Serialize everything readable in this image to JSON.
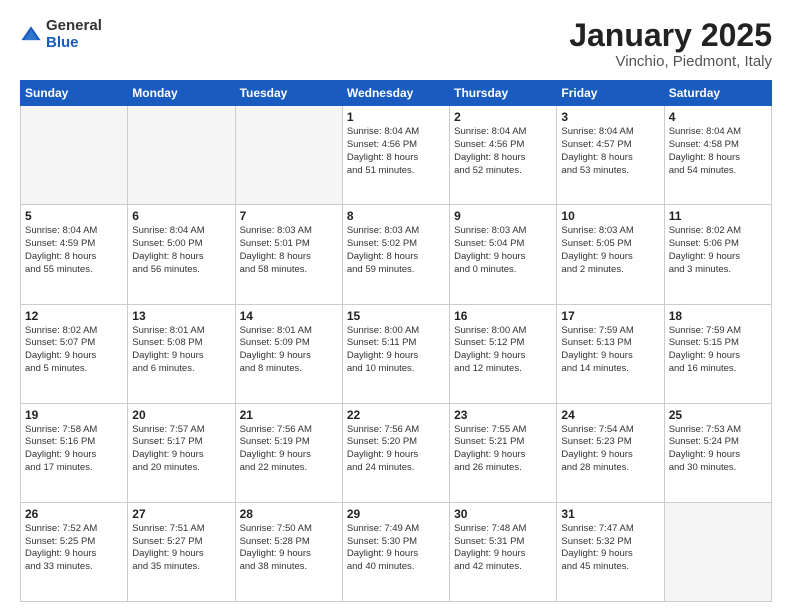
{
  "header": {
    "logo": {
      "general": "General",
      "blue": "Blue"
    },
    "title": "January 2025",
    "location": "Vinchio, Piedmont, Italy"
  },
  "weekdays": [
    "Sunday",
    "Monday",
    "Tuesday",
    "Wednesday",
    "Thursday",
    "Friday",
    "Saturday"
  ],
  "weeks": [
    [
      {
        "day": "",
        "detail": ""
      },
      {
        "day": "",
        "detail": ""
      },
      {
        "day": "",
        "detail": ""
      },
      {
        "day": "1",
        "detail": "Sunrise: 8:04 AM\nSunset: 4:56 PM\nDaylight: 8 hours\nand 51 minutes."
      },
      {
        "day": "2",
        "detail": "Sunrise: 8:04 AM\nSunset: 4:56 PM\nDaylight: 8 hours\nand 52 minutes."
      },
      {
        "day": "3",
        "detail": "Sunrise: 8:04 AM\nSunset: 4:57 PM\nDaylight: 8 hours\nand 53 minutes."
      },
      {
        "day": "4",
        "detail": "Sunrise: 8:04 AM\nSunset: 4:58 PM\nDaylight: 8 hours\nand 54 minutes."
      }
    ],
    [
      {
        "day": "5",
        "detail": "Sunrise: 8:04 AM\nSunset: 4:59 PM\nDaylight: 8 hours\nand 55 minutes."
      },
      {
        "day": "6",
        "detail": "Sunrise: 8:04 AM\nSunset: 5:00 PM\nDaylight: 8 hours\nand 56 minutes."
      },
      {
        "day": "7",
        "detail": "Sunrise: 8:03 AM\nSunset: 5:01 PM\nDaylight: 8 hours\nand 58 minutes."
      },
      {
        "day": "8",
        "detail": "Sunrise: 8:03 AM\nSunset: 5:02 PM\nDaylight: 8 hours\nand 59 minutes."
      },
      {
        "day": "9",
        "detail": "Sunrise: 8:03 AM\nSunset: 5:04 PM\nDaylight: 9 hours\nand 0 minutes."
      },
      {
        "day": "10",
        "detail": "Sunrise: 8:03 AM\nSunset: 5:05 PM\nDaylight: 9 hours\nand 2 minutes."
      },
      {
        "day": "11",
        "detail": "Sunrise: 8:02 AM\nSunset: 5:06 PM\nDaylight: 9 hours\nand 3 minutes."
      }
    ],
    [
      {
        "day": "12",
        "detail": "Sunrise: 8:02 AM\nSunset: 5:07 PM\nDaylight: 9 hours\nand 5 minutes."
      },
      {
        "day": "13",
        "detail": "Sunrise: 8:01 AM\nSunset: 5:08 PM\nDaylight: 9 hours\nand 6 minutes."
      },
      {
        "day": "14",
        "detail": "Sunrise: 8:01 AM\nSunset: 5:09 PM\nDaylight: 9 hours\nand 8 minutes."
      },
      {
        "day": "15",
        "detail": "Sunrise: 8:00 AM\nSunset: 5:11 PM\nDaylight: 9 hours\nand 10 minutes."
      },
      {
        "day": "16",
        "detail": "Sunrise: 8:00 AM\nSunset: 5:12 PM\nDaylight: 9 hours\nand 12 minutes."
      },
      {
        "day": "17",
        "detail": "Sunrise: 7:59 AM\nSunset: 5:13 PM\nDaylight: 9 hours\nand 14 minutes."
      },
      {
        "day": "18",
        "detail": "Sunrise: 7:59 AM\nSunset: 5:15 PM\nDaylight: 9 hours\nand 16 minutes."
      }
    ],
    [
      {
        "day": "19",
        "detail": "Sunrise: 7:58 AM\nSunset: 5:16 PM\nDaylight: 9 hours\nand 17 minutes."
      },
      {
        "day": "20",
        "detail": "Sunrise: 7:57 AM\nSunset: 5:17 PM\nDaylight: 9 hours\nand 20 minutes."
      },
      {
        "day": "21",
        "detail": "Sunrise: 7:56 AM\nSunset: 5:19 PM\nDaylight: 9 hours\nand 22 minutes."
      },
      {
        "day": "22",
        "detail": "Sunrise: 7:56 AM\nSunset: 5:20 PM\nDaylight: 9 hours\nand 24 minutes."
      },
      {
        "day": "23",
        "detail": "Sunrise: 7:55 AM\nSunset: 5:21 PM\nDaylight: 9 hours\nand 26 minutes."
      },
      {
        "day": "24",
        "detail": "Sunrise: 7:54 AM\nSunset: 5:23 PM\nDaylight: 9 hours\nand 28 minutes."
      },
      {
        "day": "25",
        "detail": "Sunrise: 7:53 AM\nSunset: 5:24 PM\nDaylight: 9 hours\nand 30 minutes."
      }
    ],
    [
      {
        "day": "26",
        "detail": "Sunrise: 7:52 AM\nSunset: 5:25 PM\nDaylight: 9 hours\nand 33 minutes."
      },
      {
        "day": "27",
        "detail": "Sunrise: 7:51 AM\nSunset: 5:27 PM\nDaylight: 9 hours\nand 35 minutes."
      },
      {
        "day": "28",
        "detail": "Sunrise: 7:50 AM\nSunset: 5:28 PM\nDaylight: 9 hours\nand 38 minutes."
      },
      {
        "day": "29",
        "detail": "Sunrise: 7:49 AM\nSunset: 5:30 PM\nDaylight: 9 hours\nand 40 minutes."
      },
      {
        "day": "30",
        "detail": "Sunrise: 7:48 AM\nSunset: 5:31 PM\nDaylight: 9 hours\nand 42 minutes."
      },
      {
        "day": "31",
        "detail": "Sunrise: 7:47 AM\nSunset: 5:32 PM\nDaylight: 9 hours\nand 45 minutes."
      },
      {
        "day": "",
        "detail": ""
      }
    ]
  ]
}
